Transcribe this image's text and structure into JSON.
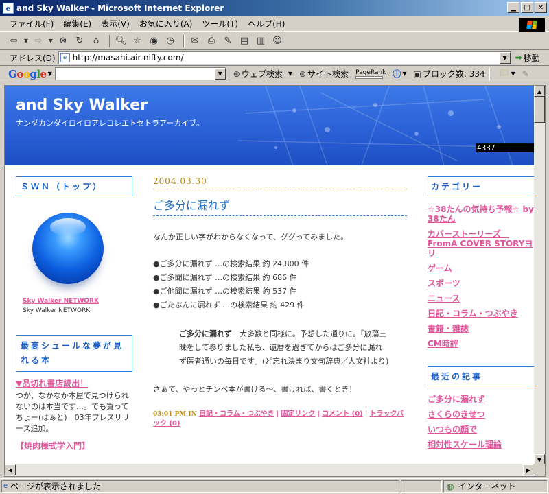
{
  "window": {
    "title": "and Sky Walker - Microsoft Internet Explorer"
  },
  "menu": [
    "ファイル(F)",
    "編集(E)",
    "表示(V)",
    "お気に入り(A)",
    "ツール(T)",
    "ヘルプ(H)"
  ],
  "address": {
    "label": "アドレス(D)",
    "url": "http://masahi.air-nifty.com/",
    "go_label": "移動"
  },
  "google_toolbar": {
    "logo": "Google",
    "web_search": "ウェブ検索",
    "site_search": "サイト検索",
    "pagerank": "PageRank",
    "blocked": "ブロック数: 334"
  },
  "banner": {
    "title": "and Sky Walker",
    "description": "ナンダカンダイロイロアレコレエトセトラアーカイブ。",
    "counter": "4337"
  },
  "left": {
    "box1": "ＳＷＮ（トップ）",
    "network_link": "Sky Walker NETWORK",
    "network_sub": "Sky Walker NETWORK",
    "box2": "最高シュールな夢が見れる本",
    "book_link": "▼品切れ書店続出！",
    "book_text": "つか、なかなか本屋で見つけられないのは本当です…。でも買ってちょー(はぁと)　03年プレスリリース追加。",
    "book_link2": "【焼肉様式学入門】"
  },
  "post": {
    "date": "2004.03.30",
    "title": "ご多分に漏れず",
    "intro": "なんか正しい字がわからなくなって、ググってみました。",
    "results": [
      "●ご多分に漏れず …の検索結果 約 24,800 件",
      "●ご多聞に漏れず …の検索結果 約 686 件",
      "●ご他聞に漏れず …の検索結果 約 537 件",
      "●ごたぶんに漏れず …の検索結果 約 429 件"
    ],
    "quote_term": "ご多分に漏れず",
    "quote_body": "大多数と同様に。予想した通りに。「放蕩三昧をして参りました私も、還暦を過ぎてからはご多分に漏れず医者通いの毎日です」(ど忘れ決まり文句辞典／人文社より)",
    "closing": "さぁて、やっとチンペ本が書ける～、書ければ、書くとき！",
    "footer_time": "03:01 PM IN",
    "footer_category": "日記・コラム・つぶやき",
    "permalink": "固定リンク",
    "comments": "コメント (0)",
    "trackback": "トラックバック (0)"
  },
  "right": {
    "categories_title": "カテゴリー",
    "categories": [
      "☆38たんの気持ち予報☆ by 38たん",
      "カバーストーリーズ　FromA COVER STORYヨリ",
      "ゲーム",
      "スポーツ",
      "ニュース",
      "日記・コラム・つぶやき",
      "書籍・雑誌",
      "CM時評"
    ],
    "recent_title": "最近の記事",
    "recent": [
      "ご多分に漏れず",
      "さくらのきせつ",
      "いつもの顔で",
      "相対性スケール理論"
    ]
  },
  "status": {
    "text": "ページが表示されました",
    "zone": "インターネット"
  }
}
